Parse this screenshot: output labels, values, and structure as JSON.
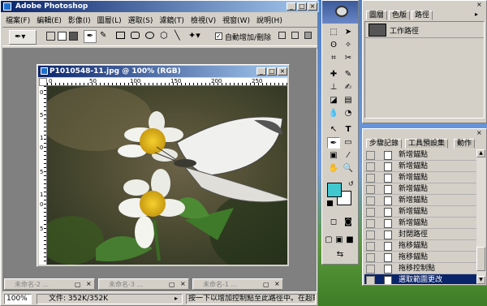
{
  "app": {
    "title": "Adobe Photoshop",
    "titlebar_color": "#0a246a"
  },
  "menu": [
    "檔案(F)",
    "編輯(E)",
    "影像(I)",
    "圖層(L)",
    "選取(S)",
    "濾鏡(T)",
    "檢視(V)",
    "視窗(W)",
    "說明(H)"
  ],
  "options_bar": {
    "auto_add_delete_label": "自動增加/刪除",
    "auto_add_delete_checked": true
  },
  "document": {
    "title": "P1010548-11.jpg @ 100% (RGB)",
    "ruler_h": [
      "0",
      "50",
      "100",
      "150",
      "200",
      "250"
    ],
    "ruler_v": [
      "0",
      "5",
      "1",
      "0",
      "5",
      "1",
      "0",
      "5"
    ]
  },
  "minimized": [
    {
      "title": "未命名-2 ..."
    },
    {
      "title": "未命名-3 ..."
    },
    {
      "title": "未命名-1 ..."
    }
  ],
  "status": {
    "zoom": "100%",
    "doc_info": "文件: 352K/352K",
    "hint": "按一下以增加控制點至此路徑中。在超鏈"
  },
  "paths_panel": {
    "tabs": [
      "圖層",
      "色版",
      "路徑"
    ],
    "active_tab": "路徑",
    "path_name": "工作路徑"
  },
  "history_panel": {
    "tabs": [
      "步驟記錄",
      "工具預設集",
      "動作"
    ],
    "active_tab": "步驟記錄",
    "items": [
      "新增錨點",
      "新增錨點",
      "新增錨點",
      "新增錨點",
      "新增錨點",
      "新增錨點",
      "新增錨點",
      "封閉路徑",
      "拖移錨點",
      "拖移錨點",
      "拖移控制點",
      "選取範圍更改"
    ],
    "selected_index": 11
  },
  "colors": {
    "foreground": "#40c8d0",
    "background": "#ffffff",
    "selection": "#0a246a"
  }
}
